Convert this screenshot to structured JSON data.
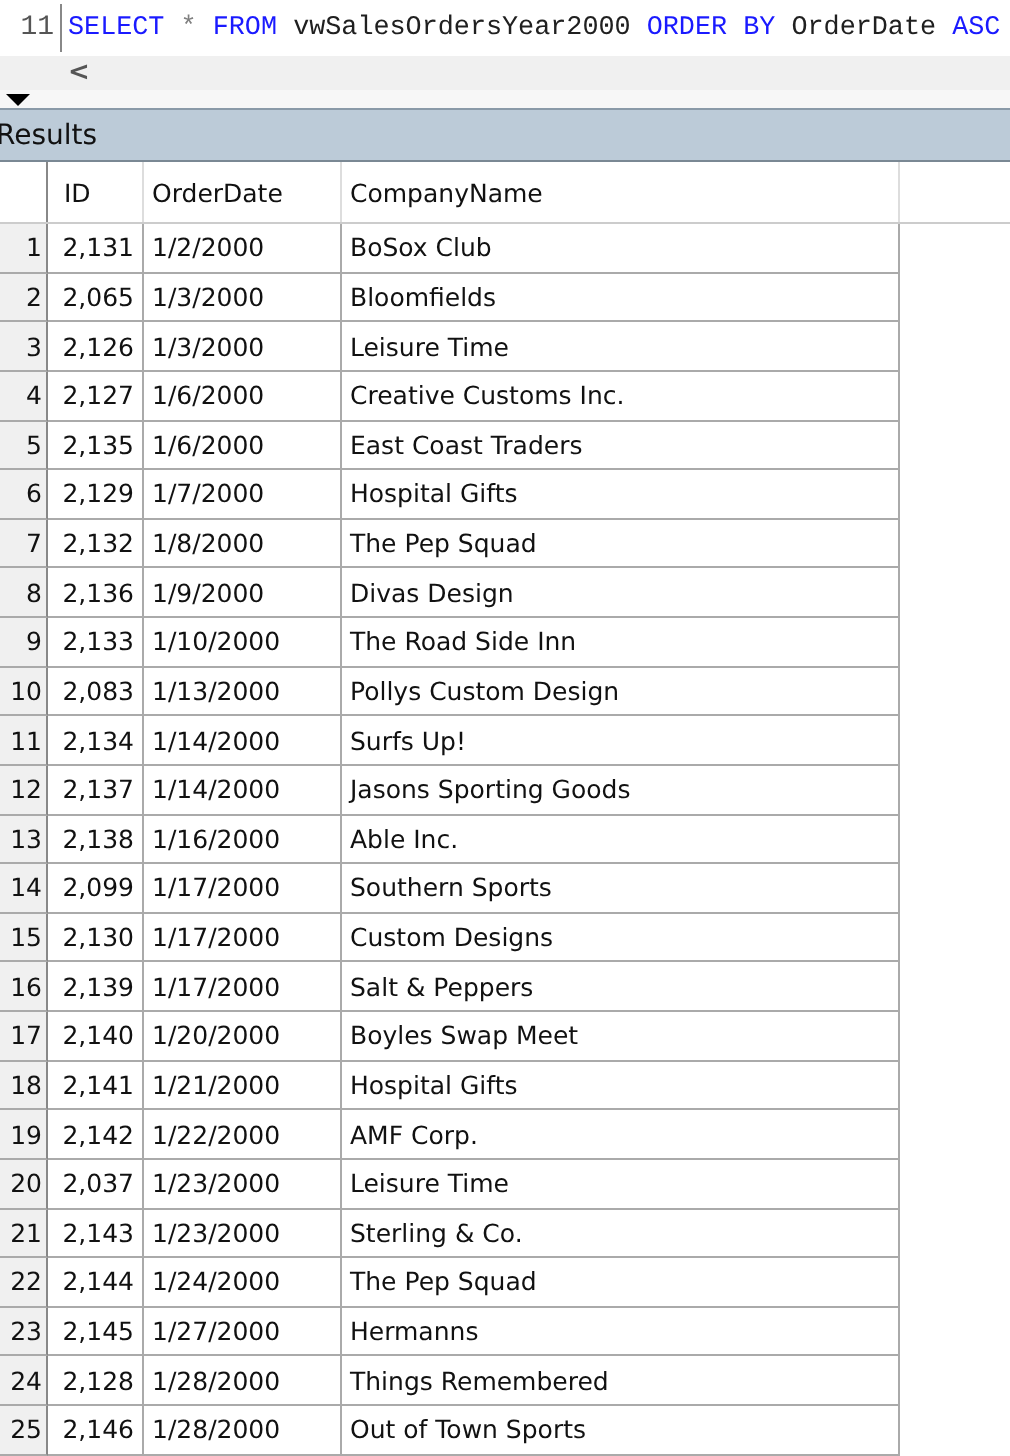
{
  "editor": {
    "line_number": "11",
    "tokens": [
      {
        "text": "SELECT",
        "kind": "keyword"
      },
      {
        "text": "*",
        "kind": "operator"
      },
      {
        "text": "FROM",
        "kind": "keyword"
      },
      {
        "text": "vwSalesOrdersYear2000",
        "kind": "identifier"
      },
      {
        "text": "ORDER",
        "kind": "keyword"
      },
      {
        "text": "BY",
        "kind": "keyword"
      },
      {
        "text": "OrderDate",
        "kind": "identifier"
      },
      {
        "text": "ASC",
        "kind": "keyword"
      }
    ],
    "scroll_left": "<"
  },
  "results": {
    "title": "Results",
    "columns": [
      "ID",
      "OrderDate",
      "CompanyName"
    ],
    "rows": [
      {
        "row": "1",
        "id": "2,131",
        "date": "1/2/2000",
        "company": "BoSox Club"
      },
      {
        "row": "2",
        "id": "2,065",
        "date": "1/3/2000",
        "company": "Bloomfields"
      },
      {
        "row": "3",
        "id": "2,126",
        "date": "1/3/2000",
        "company": "Leisure Time"
      },
      {
        "row": "4",
        "id": "2,127",
        "date": "1/6/2000",
        "company": "Creative Customs Inc."
      },
      {
        "row": "5",
        "id": "2,135",
        "date": "1/6/2000",
        "company": "East Coast Traders"
      },
      {
        "row": "6",
        "id": "2,129",
        "date": "1/7/2000",
        "company": "Hospital Gifts"
      },
      {
        "row": "7",
        "id": "2,132",
        "date": "1/8/2000",
        "company": "The Pep Squad"
      },
      {
        "row": "8",
        "id": "2,136",
        "date": "1/9/2000",
        "company": "Divas Design"
      },
      {
        "row": "9",
        "id": "2,133",
        "date": "1/10/2000",
        "company": "The Road Side Inn"
      },
      {
        "row": "10",
        "id": "2,083",
        "date": "1/13/2000",
        "company": "Pollys Custom Design"
      },
      {
        "row": "11",
        "id": "2,134",
        "date": "1/14/2000",
        "company": "Surfs Up!"
      },
      {
        "row": "12",
        "id": "2,137",
        "date": "1/14/2000",
        "company": "Jasons Sporting Goods"
      },
      {
        "row": "13",
        "id": "2,138",
        "date": "1/16/2000",
        "company": "Able Inc."
      },
      {
        "row": "14",
        "id": "2,099",
        "date": "1/17/2000",
        "company": "Southern Sports"
      },
      {
        "row": "15",
        "id": "2,130",
        "date": "1/17/2000",
        "company": "Custom Designs"
      },
      {
        "row": "16",
        "id": "2,139",
        "date": "1/17/2000",
        "company": "Salt & Peppers"
      },
      {
        "row": "17",
        "id": "2,140",
        "date": "1/20/2000",
        "company": "Boyles Swap Meet"
      },
      {
        "row": "18",
        "id": "2,141",
        "date": "1/21/2000",
        "company": "Hospital Gifts"
      },
      {
        "row": "19",
        "id": "2,142",
        "date": "1/22/2000",
        "company": "AMF Corp."
      },
      {
        "row": "20",
        "id": "2,037",
        "date": "1/23/2000",
        "company": "Leisure Time"
      },
      {
        "row": "21",
        "id": "2,143",
        "date": "1/23/2000",
        "company": "Sterling & Co."
      },
      {
        "row": "22",
        "id": "2,144",
        "date": "1/24/2000",
        "company": "The Pep Squad"
      },
      {
        "row": "23",
        "id": "2,145",
        "date": "1/27/2000",
        "company": "Hermanns"
      },
      {
        "row": "24",
        "id": "2,128",
        "date": "1/28/2000",
        "company": "Things Remembered"
      },
      {
        "row": "25",
        "id": "2,146",
        "date": "1/28/2000",
        "company": "Out of Town Sports"
      }
    ]
  }
}
